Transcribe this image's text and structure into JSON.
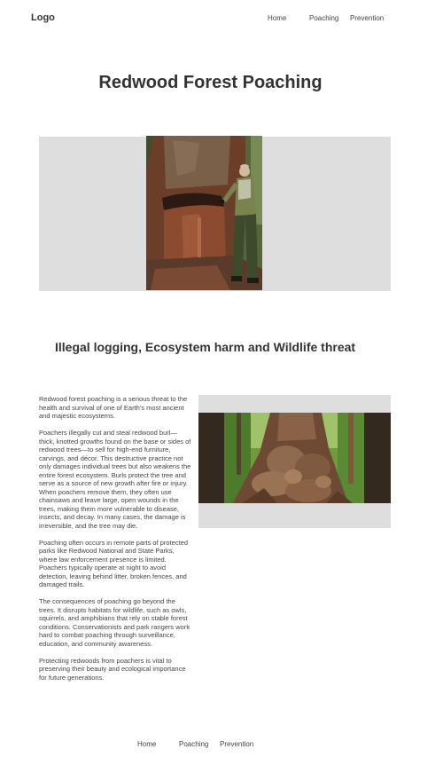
{
  "header": {
    "logo": "Logo",
    "nav": [
      "Home",
      "Poaching",
      "Prevention"
    ]
  },
  "hero": {
    "title": "Redwood Forest Poaching",
    "image_alt": "Ranger standing next to a poached redwood trunk"
  },
  "section": {
    "heading": "Illegal logging, Ecosystem harm and Wildlife threat",
    "paragraphs": [
      "Redwood forest poaching is a serious threat to the health and survival of one of Earth's most ancient and majestic ecosystems.",
      "Poachers illegally cut and steal redwood burl—thick, knotted growths found on the base or sides of redwood trees—to sell for high-end furniture, carvings, and décor. This destructive practice not only damages individual trees but also weakens the entire forest ecosystem. Burls protect the tree and serve as a source of new growth after fire or injury. When poachers remove them, they often use chainsaws and leave large, open wounds in the trees, making them more vulnerable to disease, insects, and decay. In many cases, the damage is irreversible, and the tree may die.",
      "Poaching often occurs in remote parts of protected parks like Redwood National and State Parks, where law enforcement presence is limited. Poachers typically operate at night to avoid detection, leaving behind litter, broken fences, and damaged trails.",
      "The consequences of poaching go beyond the trees. It disrupts habitats for wildlife, such as owls, squirrels, and amphibians that rely on stable forest conditions. Conservationists and park rangers work hard to combat poaching through surveillance, education, and community awareness.",
      "Protecting redwoods from poachers is vital to preserving their beauty and ecological importance for future generations."
    ],
    "image_alt": "Redwood trunk with large burls"
  },
  "footer": {
    "nav": [
      "Home",
      "Poaching",
      "Prevention"
    ]
  }
}
